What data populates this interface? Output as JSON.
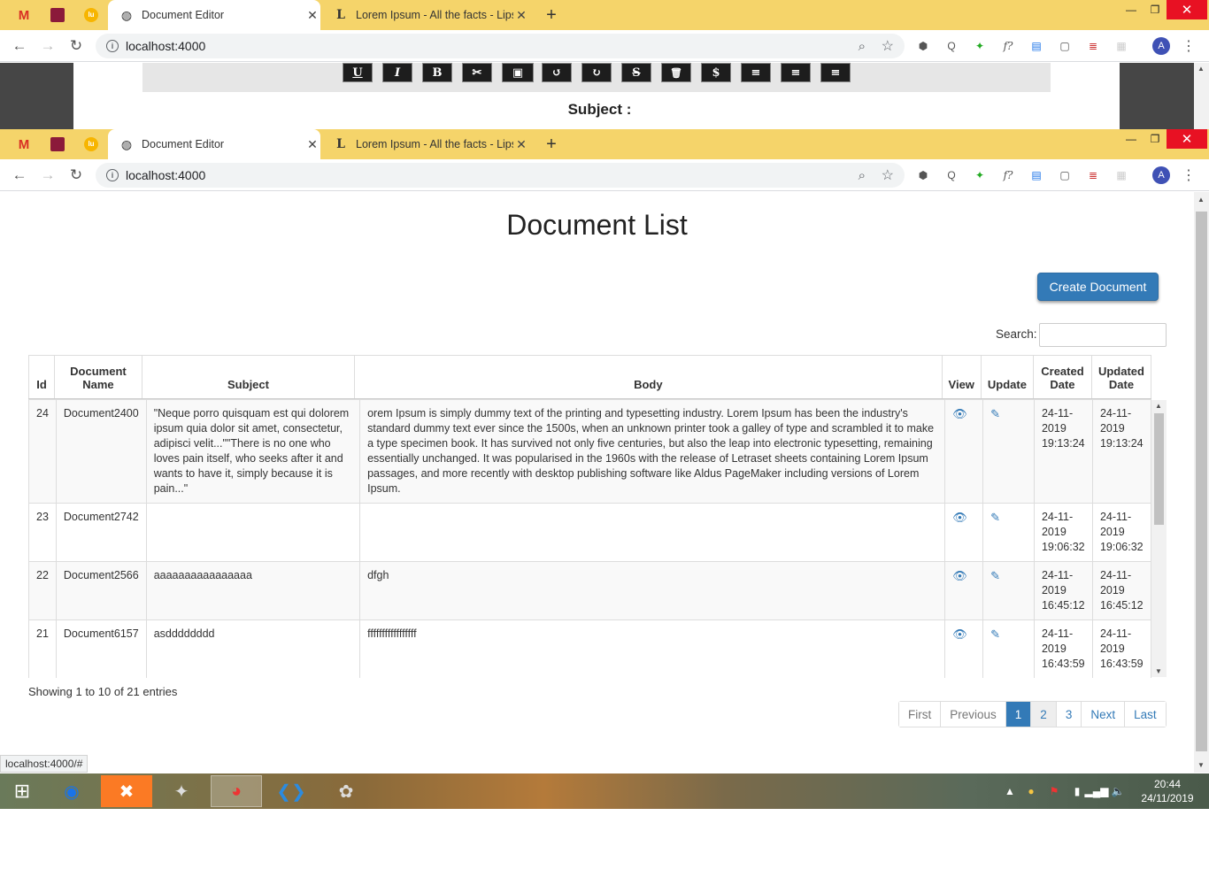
{
  "browser": {
    "tabs": [
      {
        "title": "Document Editor",
        "active": true
      },
      {
        "title": "Lorem Ipsum - All the facts - Lips",
        "active": false
      }
    ],
    "url": "localhost:4000",
    "avatar_letter": "A",
    "window_controls": {
      "minimize": "—",
      "maximize": "❐",
      "close": "✕"
    },
    "new_tab": "+"
  },
  "editor_strip": {
    "buttons": [
      "U",
      "I",
      "B",
      "✂",
      "▣",
      "↺",
      "↻",
      "S",
      "🗑",
      "$",
      "≡",
      "≡",
      "≡"
    ],
    "subject_label": "Subject :"
  },
  "page": {
    "title": "Document List",
    "create_button": "Create Document",
    "search_label": "Search:",
    "search_value": "",
    "columns": [
      "Id",
      "Document Name",
      "Subject",
      "Body",
      "View",
      "Update",
      "Created Date",
      "Updated Date"
    ],
    "rows": [
      {
        "id": "24",
        "name": "Document2400",
        "subject": "\"Neque porro quisquam est qui dolorem ipsum quia dolor sit amet, consectetur, adipisci velit...\"\"There is no one who loves pain itself, who seeks after it and wants to have it, simply because it is pain...\"",
        "body": "orem Ipsum is simply dummy text of the printing and typesetting industry. Lorem Ipsum has been the industry's standard dummy text ever since the 1500s, when an unknown printer took a galley of type and scrambled it to make a type specimen book. It has survived not only five centuries, but also the leap into electronic typesetting, remaining essentially unchanged. It was popularised in the 1960s with the release of Letraset sheets containing Lorem Ipsum passages, and more recently with desktop publishing software like Aldus PageMaker including versions of Lorem Ipsum.",
        "created": "24-11-2019 19:13:24",
        "updated": "24-11-2019 19:13:24"
      },
      {
        "id": "23",
        "name": "Document2742",
        "subject": "",
        "body": "",
        "created": "24-11-2019 19:06:32",
        "updated": "24-11-2019 19:06:32"
      },
      {
        "id": "22",
        "name": "Document2566",
        "subject": "aaaaaaaaaaaaaaaa",
        "body": "dfgh",
        "created": "24-11-2019 16:45:12",
        "updated": "24-11-2019 16:45:12"
      },
      {
        "id": "21",
        "name": "Document6157",
        "subject": "asdddddddd",
        "body": "fffffffffffffffff",
        "created": "24-11-2019 16:43:59",
        "updated": "24-11-2019 16:43:59"
      }
    ],
    "info": "Showing 1 to 10 of 21 entries",
    "pagination": [
      "First",
      "Previous",
      "1",
      "2",
      "3",
      "Next",
      "Last"
    ],
    "pagination_active": "1"
  },
  "status_url": "localhost:4000/#",
  "taskbar": {
    "time": "20:44",
    "date": "24/11/2019"
  },
  "colors": {
    "tabbar": "#f5d46a",
    "primary": "#337ab7",
    "close_red": "#e81123"
  }
}
